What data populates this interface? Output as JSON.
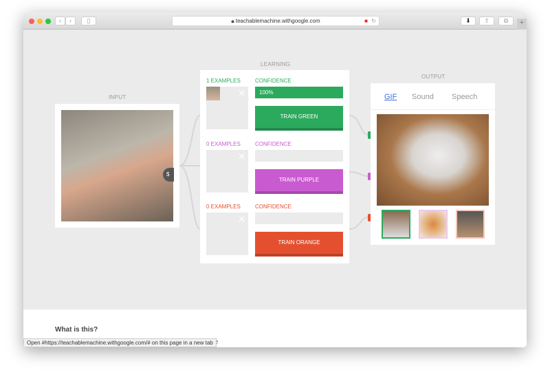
{
  "browser": {
    "url": "teachablemachine.withgoogle.com",
    "status_tooltip": "Open #https://teachablemachine.withgoogle.com/# on this page in a new tab"
  },
  "input": {
    "label": "INPUT"
  },
  "learning": {
    "label": "LEARNING",
    "classes": [
      {
        "examples": "1 EXAMPLES",
        "confidence_label": "CONFIDENCE",
        "confidence_value": "100%",
        "confidence": 1.0,
        "train": "TRAIN GREEN",
        "color": "#2baa5e"
      },
      {
        "examples": "0 EXAMPLES",
        "confidence_label": "CONFIDENCE",
        "confidence_value": "",
        "confidence": 0,
        "train": "TRAIN PURPLE",
        "color": "#c95bd0"
      },
      {
        "examples": "0 EXAMPLES",
        "confidence_label": "CONFIDENCE",
        "confidence_value": "",
        "confidence": 0,
        "train": "TRAIN ORANGE",
        "color": "#e4502f"
      }
    ]
  },
  "output": {
    "label": "OUTPUT",
    "tabs": [
      "GIF",
      "Sound",
      "Speech"
    ],
    "active_tab": "GIF"
  },
  "info": {
    "heading": "What is this?",
    "partial_text": "ine"
  }
}
